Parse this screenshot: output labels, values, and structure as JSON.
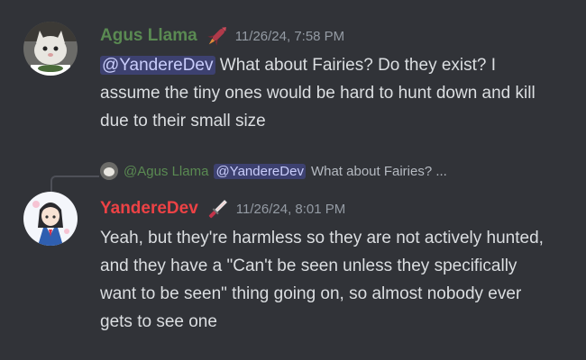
{
  "messages": [
    {
      "author": "Agus Llama",
      "author_color": "#5a8a52",
      "role_icon": "rocket-icon",
      "timestamp": "11/26/24, 7:58 PM",
      "mention": "@YandereDev",
      "text": " What about Fairies? Do they exist? I assume the tiny ones would be hard to hunt down and kill due to their small size"
    },
    {
      "author": "YandereDev",
      "author_color": "#ed4245",
      "role_icon": "knife-icon",
      "timestamp": "11/26/24, 8:01 PM",
      "text": "Yeah, but they're harmless so they are not actively hunted, and they have a \"Can't be seen unless they specifically want to be seen\" thing going on, so almost nobody ever gets to see one",
      "reply": {
        "author": "@Agus Llama",
        "mention": "@YandereDev",
        "preview": "What about Fairies? ..."
      }
    }
  ]
}
